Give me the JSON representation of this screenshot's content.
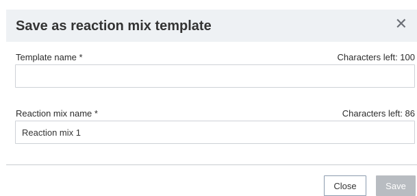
{
  "dialog": {
    "title": "Save as reaction mix template",
    "close_icon": "close-icon"
  },
  "template_name": {
    "label": "Template name *",
    "chars_left": "Characters left: 100",
    "value": ""
  },
  "reaction_mix_name": {
    "label": "Reaction mix name *",
    "chars_left": "Characters left: 86",
    "value": "Reaction mix 1"
  },
  "footer": {
    "close_label": "Close",
    "save_label": "Save"
  },
  "colors": {
    "header_bg": "#eef1f4",
    "save_disabled_bg": "#b8bcc1",
    "close_border": "#8a9aae"
  }
}
